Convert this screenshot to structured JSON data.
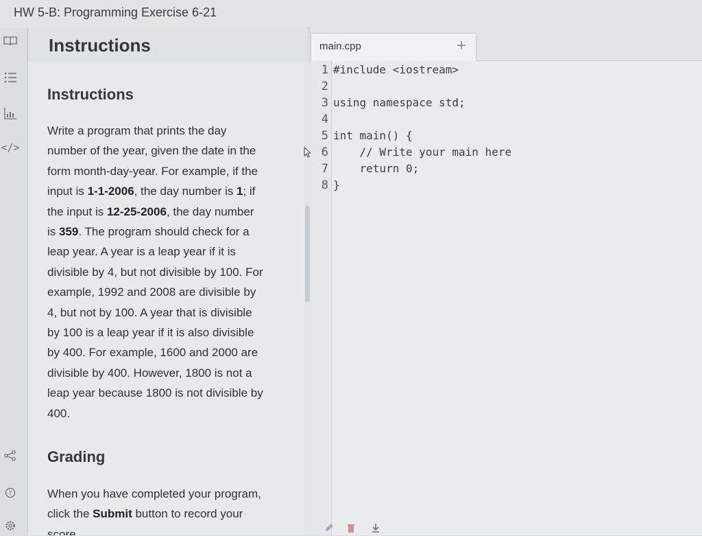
{
  "window": {
    "title": "HW 5-B: Programming Exercise 6-21"
  },
  "sidebar": {
    "icons": [
      "book-icon",
      "list-icon",
      "chart-icon",
      "code-icon",
      "share-icon",
      "help-icon",
      "gear-icon"
    ],
    "code_glyph": "</>"
  },
  "instructions": {
    "header_title": "Instructions",
    "section_title": "Instructions",
    "body_lines": [
      "Write a program that prints the day",
      "number of the year, given the date in the",
      "form month-day-year. For example, if the",
      "input is 1-1-2006, the day number is 1; if",
      "the input is 12-25-2006, the day number",
      "is 359. The program should check for a",
      "leap year. A year is a leap year if it is",
      "divisible by 4, but not divisible by 100. For",
      "example, 1992 and 2008 are divisible by",
      "4, but not by 100. A year that is divisible",
      "by 100 is a leap year if it is also divisible",
      "by 400. For example, 1600 and 2000 are",
      "divisible by 400. However, 1800 is not a",
      "leap year because 1800 is not divisible by",
      "400."
    ],
    "grading_title": "Grading",
    "grading_lines": [
      "When you have completed your program,",
      "click the Submit button to record your",
      "score."
    ]
  },
  "editor": {
    "tab_label": "main.cpp",
    "add_tab_label": "+",
    "lines": [
      {
        "num": "1",
        "code": "#include <iostream>"
      },
      {
        "num": "2",
        "code": ""
      },
      {
        "num": "3",
        "code": "using namespace std;"
      },
      {
        "num": "4",
        "code": ""
      },
      {
        "num": "5",
        "code": "int main() {"
      },
      {
        "num": "6",
        "code": "    // Write your main here"
      },
      {
        "num": "7",
        "code": "    return 0;"
      },
      {
        "num": "8",
        "code": "}"
      }
    ]
  },
  "colors": {
    "bold_accent": "#1f2226",
    "icon_gray": "#6b7076"
  }
}
